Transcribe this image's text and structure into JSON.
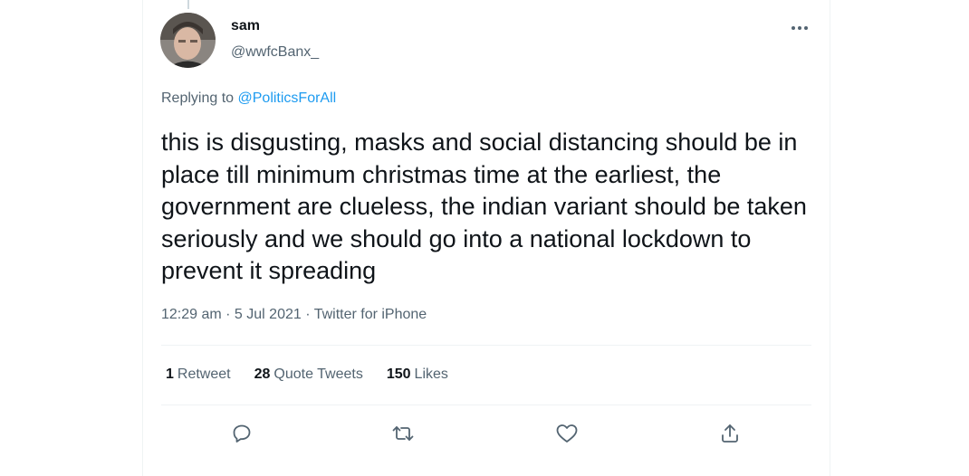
{
  "user": {
    "name": "sam",
    "handle": "@wwfcBanx_"
  },
  "reply": {
    "prefix": "Replying to",
    "to": "@PoliticsForAll"
  },
  "tweet": {
    "text": "this is disgusting, masks and social distancing should be in place till minimum christmas time at the earliest, the government are clueless, the indian variant should be taken seriously and we should go into a national lockdown to prevent it spreading",
    "meta": "12:29 am · 5 Jul 2021 · Twitter for iPhone"
  },
  "stats": {
    "retweets_count": "1",
    "retweets_label": "Retweet",
    "quotes_count": "28",
    "quotes_label": "Quote Tweets",
    "likes_count": "150",
    "likes_label": "Likes"
  },
  "actions": [
    "reply-icon",
    "retweet-icon",
    "like-icon",
    "share-icon"
  ],
  "colors": {
    "link": "#1d9bf0",
    "secondary": "#536471",
    "primary": "#0f1419",
    "divider": "#eff3f4"
  }
}
